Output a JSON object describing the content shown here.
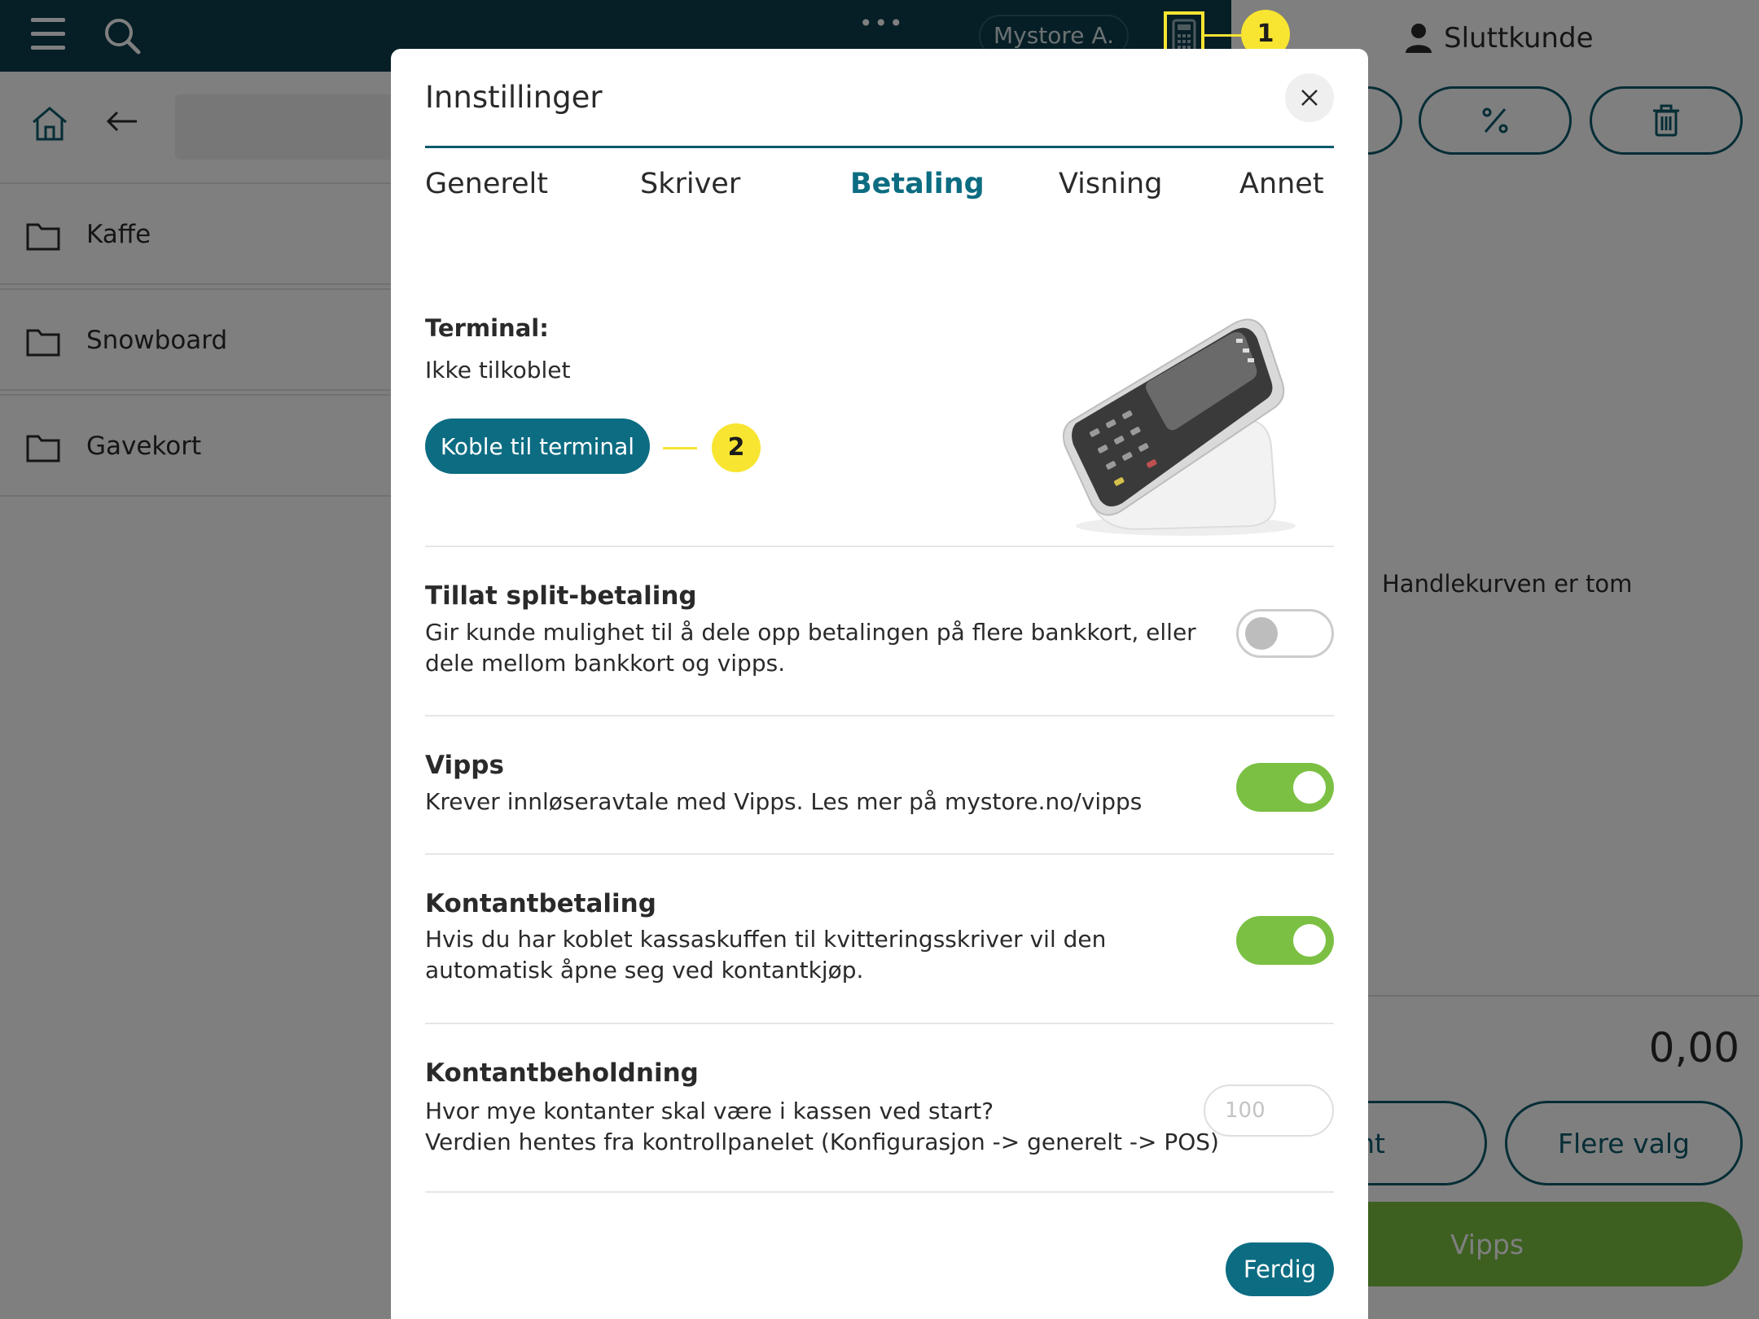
{
  "topbar": {
    "menu_icon": "hamburger-icon",
    "search_icon": "search-icon",
    "more": "•••",
    "store_name": "Mystore A.",
    "calculator_icon": "calculator-icon"
  },
  "callouts": {
    "one": "1",
    "two": "2"
  },
  "customer": {
    "label": "Sluttkunde",
    "icon": "user-icon"
  },
  "categories": [
    {
      "label": "Kaffe",
      "icon": "folder-icon"
    },
    {
      "label": "Snowboard",
      "icon": "folder-icon"
    },
    {
      "label": "Gavekort",
      "icon": "folder-icon"
    }
  ],
  "cart": {
    "empty_text": "Handlekurven er tom",
    "total": "0,00",
    "cash_button_partial": "tant",
    "more_options": "Flere valg",
    "vipps_button": "Vipps"
  },
  "modal": {
    "title": "Innstillinger",
    "tabs": [
      {
        "label": "Generelt"
      },
      {
        "label": "Skriver"
      },
      {
        "label": "Betaling"
      },
      {
        "label": "Visning"
      },
      {
        "label": "Annet"
      }
    ],
    "active_tab": "Betaling",
    "terminal": {
      "label": "Terminal:",
      "status": "Ikke tilkoblet",
      "connect_button": "Koble til terminal"
    },
    "settings": {
      "split": {
        "title": "Tillat split-betaling",
        "description": "Gir kunde mulighet til å dele opp betalingen på flere bankkort, eller dele mellom bankkort og vipps.",
        "enabled": false
      },
      "vipps": {
        "title": "Vipps",
        "description": "Krever innløseravtale med Vipps. Les mer på mystore.no/vipps",
        "enabled": true
      },
      "cash": {
        "title": "Kontantbetaling",
        "description": "Hvis du har koblet kassaskuffen til kvitteringsskriver vil den automatisk åpne seg ved kontantkjøp.",
        "enabled": true
      },
      "cash_balance": {
        "title": "Kontantbeholdning",
        "line1": "Hvor mye kontanter skal være i kassen ved start?",
        "line2": "Verdien hentes fra kontrollpanelet (Konfigurasjon -> generelt -> POS)",
        "placeholder": "100"
      }
    },
    "done_button": "Ferdig"
  },
  "colors": {
    "brand_dark": "#0c3d4d",
    "brand_accent": "#0c6c82",
    "toggle_on": "#7bc043",
    "callout": "#f7e531"
  }
}
